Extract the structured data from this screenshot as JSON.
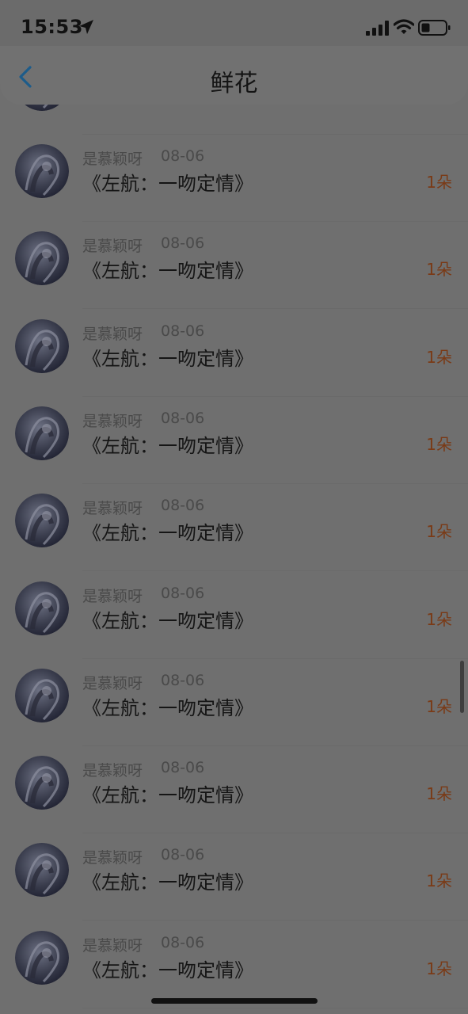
{
  "status_bar": {
    "time": "15:53"
  },
  "header": {
    "title": "鲜花",
    "back_icon": "chevron-left-icon"
  },
  "items": [
    {
      "name": "是慕颖呀",
      "date": "08-06",
      "title": "《左航：一吻定情》",
      "count": "1朵"
    },
    {
      "name": "是慕颖呀",
      "date": "08-06",
      "title": "《左航：一吻定情》",
      "count": "1朵"
    },
    {
      "name": "是慕颖呀",
      "date": "08-06",
      "title": "《左航：一吻定情》",
      "count": "1朵"
    },
    {
      "name": "是慕颖呀",
      "date": "08-06",
      "title": "《左航：一吻定情》",
      "count": "1朵"
    },
    {
      "name": "是慕颖呀",
      "date": "08-06",
      "title": "《左航：一吻定情》",
      "count": "1朵"
    },
    {
      "name": "是慕颖呀",
      "date": "08-06",
      "title": "《左航：一吻定情》",
      "count": "1朵"
    },
    {
      "name": "是慕颖呀",
      "date": "08-06",
      "title": "《左航：一吻定情》",
      "count": "1朵"
    },
    {
      "name": "是慕颖呀",
      "date": "08-06",
      "title": "《左航：一吻定情》",
      "count": "1朵"
    },
    {
      "name": "是慕颖呀",
      "date": "08-06",
      "title": "《左航：一吻定情》",
      "count": "1朵"
    },
    {
      "name": "是慕颖呀",
      "date": "08-06",
      "title": "《左航：一吻定情》",
      "count": "1朵"
    }
  ],
  "colors": {
    "accent_back": "#1d5c8a",
    "count_text": "#7a3a16",
    "overlay_background": "#6f6f6f"
  }
}
